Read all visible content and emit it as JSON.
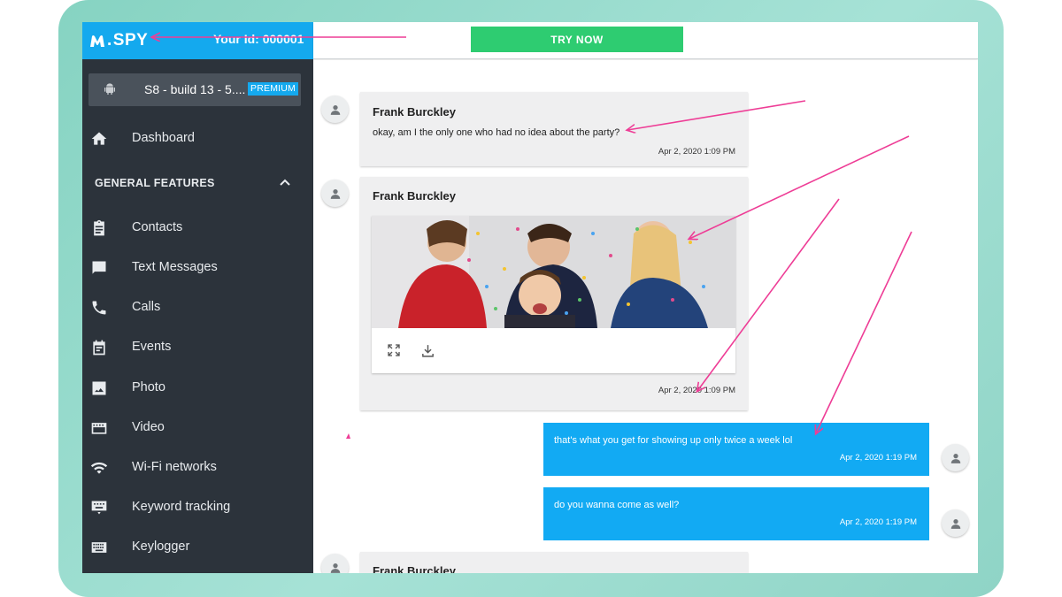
{
  "brand": {
    "logo_text": "SPY",
    "user_id": "Your Id: 000001"
  },
  "device": {
    "name": "S8 - build 13 - 5....",
    "badge": "PREMIUM"
  },
  "nav": {
    "dashboard": "Dashboard",
    "section_title": "GENERAL FEATURES",
    "items": [
      {
        "label": "Contacts",
        "icon": "clipboard-icon"
      },
      {
        "label": "Text Messages",
        "icon": "message-icon"
      },
      {
        "label": "Calls",
        "icon": "phone-icon"
      },
      {
        "label": "Events",
        "icon": "calendar-icon"
      },
      {
        "label": "Photo",
        "icon": "image-icon"
      },
      {
        "label": "Video",
        "icon": "video-icon"
      },
      {
        "label": "Wi-Fi networks",
        "icon": "wifi-icon"
      },
      {
        "label": "Keyword tracking",
        "icon": "keyword-icon"
      },
      {
        "label": "Keylogger",
        "icon": "keyboard-icon"
      }
    ]
  },
  "topbar": {
    "cta": "TRY NOW"
  },
  "messages": [
    {
      "direction": "in",
      "sender": "Frank Burckley",
      "text": "okay, am I the only one who had no idea about the party?",
      "time": "Apr 2, 2020 1:09 PM"
    },
    {
      "direction": "in",
      "sender": "Frank Burckley",
      "text": "",
      "has_photo": true,
      "time": "Apr 2, 2020 1:09 PM"
    },
    {
      "direction": "out",
      "text": "that's what you get for showing up only twice a week lol",
      "time": "Apr 2, 2020 1:19 PM"
    },
    {
      "direction": "out",
      "text": "do you wanna come as well?",
      "time": "Apr 2, 2020 1:19 PM"
    },
    {
      "direction": "in",
      "sender": "Frank Burckley"
    }
  ],
  "colors": {
    "brand_blue": "#14a9ee",
    "sidebar": "#2c333b",
    "cta_green": "#2ecc71",
    "annotation_pink": "#ee3d96"
  }
}
